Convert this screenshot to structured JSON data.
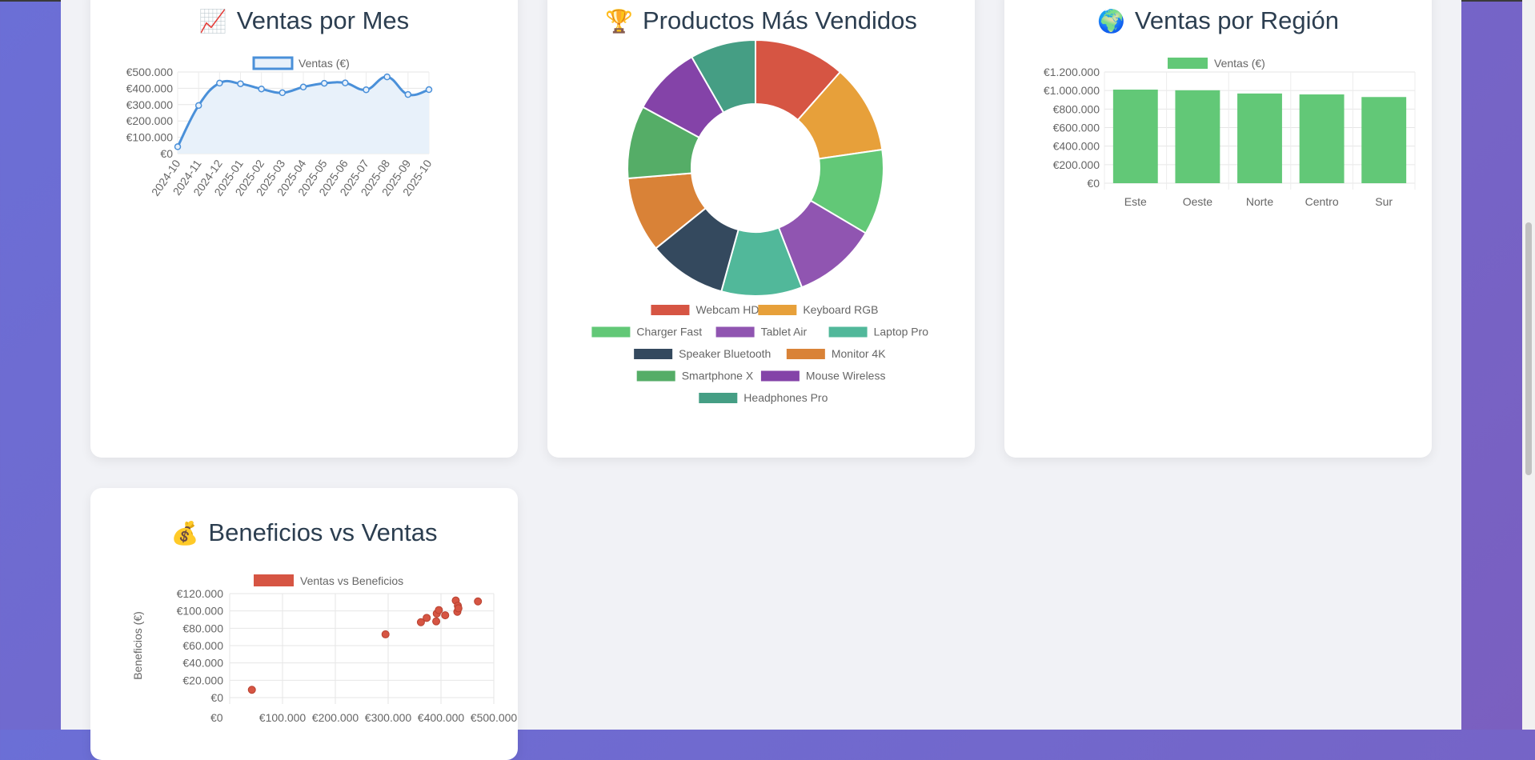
{
  "cards": {
    "sales_by_month": {
      "icon": "chart-increasing-icon",
      "emoji": "📈",
      "title": "Ventas por Mes",
      "legend": "Ventas (€)"
    },
    "top_products": {
      "icon": "trophy-icon",
      "emoji": "🏆",
      "title": "Productos Más Vendidos"
    },
    "sales_by_region": {
      "icon": "globe-icon",
      "emoji": "🌍",
      "title": "Ventas por Región",
      "legend": "Ventas (€)"
    },
    "profit_vs_sales": {
      "icon": "money-bag-icon",
      "emoji": "💰",
      "title": "Beneficios vs Ventas",
      "legend": "Ventas vs Beneficios",
      "ylabel": "Beneficios (€)"
    }
  },
  "colors": {
    "line": "#4a90d9",
    "line_fill": "#e8f1fa",
    "bar": "#62c877",
    "scatter": "#d65543"
  },
  "chart_data": [
    {
      "type": "line",
      "title": "Ventas por Mes",
      "series": [
        {
          "name": "Ventas (€)",
          "values": [
            42000,
            295000,
            432000,
            428000,
            396000,
            373000,
            408000,
            431000,
            433000,
            391000,
            470000,
            362000,
            392000
          ]
        }
      ],
      "x": [
        "2024-10",
        "2024-11",
        "2024-12",
        "2025-01",
        "2025-02",
        "2025-03",
        "2025-04",
        "2025-05",
        "2025-06",
        "2025-07",
        "2025-08",
        "2025-09",
        "2025-10"
      ],
      "ylim": [
        0,
        500000
      ],
      "yticks": [
        "€0",
        "€100.000",
        "€200.000",
        "€300.000",
        "€400.000",
        "€500.000"
      ],
      "grid": true,
      "legend": "top"
    },
    {
      "type": "pie",
      "title": "Productos Más Vendidos",
      "categories": [
        "Webcam HD",
        "Keyboard RGB",
        "Charger Fast",
        "Tablet Air",
        "Laptop Pro",
        "Speaker Bluetooth",
        "Monitor 4K",
        "Smartphone X",
        "Mouse Wireless",
        "Headphones Pro"
      ],
      "values": [
        11.5,
        11.2,
        10.8,
        10.6,
        10.2,
        9.9,
        9.5,
        9.2,
        8.8,
        8.3
      ],
      "colors": [
        "#d65543",
        "#e7a03a",
        "#62c877",
        "#9055b1",
        "#51b89a",
        "#34495e",
        "#d98237",
        "#55ad67",
        "#8443a8",
        "#459e84"
      ],
      "legend": "bottom"
    },
    {
      "type": "bar",
      "title": "Ventas por Región",
      "categories": [
        "Este",
        "Oeste",
        "Norte",
        "Centro",
        "Sur"
      ],
      "series": [
        {
          "name": "Ventas (€)",
          "values": [
            1010000,
            1003000,
            968000,
            958000,
            930000
          ]
        }
      ],
      "ylim": [
        0,
        1200000
      ],
      "yticks": [
        "€0",
        "€200.000",
        "€400.000",
        "€600.000",
        "€800.000",
        "€1.000.000",
        "€1.200.000"
      ],
      "grid": true,
      "legend": "top"
    },
    {
      "type": "scatter",
      "title": "Beneficios vs Ventas",
      "series": [
        {
          "name": "Ventas vs Beneficios",
          "points": [
            [
              42000,
              9000
            ],
            [
              295000,
              73000
            ],
            [
              362000,
              87000
            ],
            [
              373000,
              92000
            ],
            [
              391000,
              88000
            ],
            [
              392000,
              97000
            ],
            [
              396000,
              101000
            ],
            [
              408000,
              95000
            ],
            [
              428000,
              112000
            ],
            [
              431000,
              99000
            ],
            [
              432000,
              106000
            ],
            [
              433000,
              103000
            ],
            [
              470000,
              111000
            ]
          ]
        }
      ],
      "xlim": [
        0,
        500000
      ],
      "ylim": [
        0,
        120000
      ],
      "xticks": [
        "€0",
        "€100.000",
        "€200.000",
        "€300.000",
        "€400.000",
        "€500.000"
      ],
      "yticks": [
        "€0",
        "€20.000",
        "€40.000",
        "€60.000",
        "€80.000",
        "€100.000",
        "€120.000"
      ],
      "ylabel": "Beneficios (€)",
      "grid": true,
      "legend": "top"
    }
  ]
}
